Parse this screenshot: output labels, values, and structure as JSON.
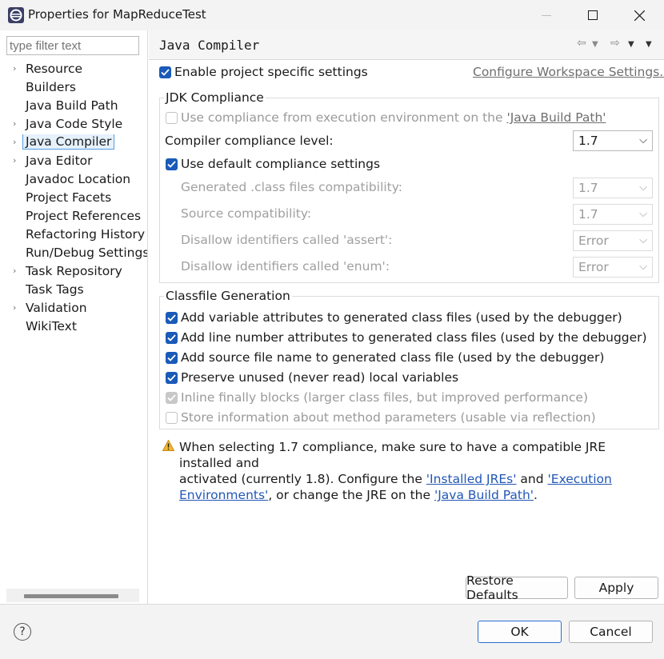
{
  "window": {
    "title": "Properties for MapReduceTest"
  },
  "filter": {
    "placeholder": "type filter text"
  },
  "tree": [
    {
      "label": "Resource",
      "expandable": true
    },
    {
      "label": "Builders",
      "expandable": false
    },
    {
      "label": "Java Build Path",
      "expandable": false
    },
    {
      "label": "Java Code Style",
      "expandable": true
    },
    {
      "label": "Java Compiler",
      "expandable": true,
      "selected": true
    },
    {
      "label": "Java Editor",
      "expandable": true
    },
    {
      "label": "Javadoc Location",
      "expandable": false
    },
    {
      "label": "Project Facets",
      "expandable": false
    },
    {
      "label": "Project References",
      "expandable": false
    },
    {
      "label": "Refactoring History",
      "expandable": false
    },
    {
      "label": "Run/Debug Settings",
      "expandable": false
    },
    {
      "label": "Task Repository",
      "expandable": true
    },
    {
      "label": "Task Tags",
      "expandable": false
    },
    {
      "label": "Validation",
      "expandable": true
    },
    {
      "label": "WikiText",
      "expandable": false
    }
  ],
  "page": {
    "title": "Java Compiler",
    "enable_specific": "Enable project specific settings",
    "configure_link": "Configure Workspace Settings..."
  },
  "jdk": {
    "title": "JDK Compliance",
    "use_env_prefix": "Use compliance from execution environment on the ",
    "use_env_link": "'Java Build Path'",
    "compliance_label": "Compiler compliance level:",
    "compliance_value": "1.7",
    "use_default": "Use default compliance settings",
    "generated_label": "Generated .class files compatibility:",
    "generated_value": "1.7",
    "source_label": "Source compatibility:",
    "source_value": "1.7",
    "assert_label": "Disallow identifiers called 'assert':",
    "assert_value": "Error",
    "enum_label": "Disallow identifiers called 'enum':",
    "enum_value": "Error"
  },
  "classfile": {
    "title": "Classfile Generation",
    "items": [
      "Add variable attributes to generated class files (used by the debugger)",
      "Add line number attributes to generated class files (used by the debugger)",
      "Add source file name to generated class file (used by the debugger)",
      "Preserve unused (never read) local variables",
      "Inline finally blocks (larger class files, but improved performance)",
      "Store information about method parameters (usable via reflection)"
    ]
  },
  "warning": {
    "line1": "When selecting 1.7 compliance, make sure to have a compatible JRE installed and",
    "line2_prefix": "activated (currently 1.8). Configure the ",
    "link_jres": "'Installed JREs'",
    "and": " and ",
    "link_env_1": "'Execution",
    "link_env_2": "Environments'",
    "line3_mid": ", or change the JRE on the ",
    "link_build_path": "'Java Build Path'",
    "line3_end": "."
  },
  "buttons": {
    "restore": "Restore Defaults",
    "apply": "Apply",
    "ok": "OK",
    "cancel": "Cancel",
    "help": "?"
  },
  "colors": {
    "accent": "#1a5ab8",
    "link": "#2257b5",
    "warning": "#e8a316"
  }
}
